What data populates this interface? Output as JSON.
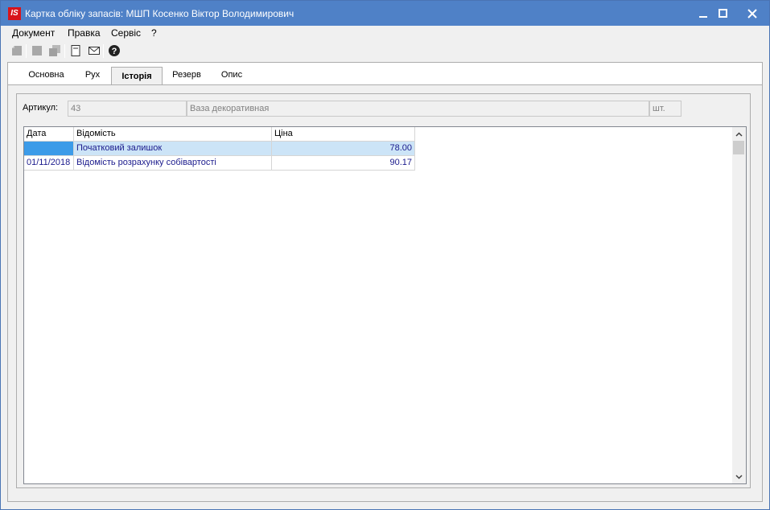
{
  "window": {
    "title": "Картка обліку запасів: МШП Косенко Віктор Володимирович",
    "logo_text": "IS",
    "colors": {
      "titlebar": "#4f81c7",
      "logo": "#d8141b",
      "selection": "#cce4f7",
      "selection_marker": "#3c9be8"
    }
  },
  "menu": {
    "items": [
      "Документ",
      "Правка",
      "Сервіс",
      "?"
    ]
  },
  "toolbar": {
    "icons": [
      "new-disabled-icon",
      "save-disabled-icon",
      "copy-disabled-icon",
      "document-icon",
      "mail-icon",
      "help-icon"
    ]
  },
  "tabs": [
    {
      "label": "Основна",
      "active": false
    },
    {
      "label": "Рух",
      "active": false
    },
    {
      "label": "Історія",
      "active": true
    },
    {
      "label": "Резерв",
      "active": false
    },
    {
      "label": "Опис",
      "active": false
    }
  ],
  "article": {
    "label": "Артикул:",
    "code": "43",
    "name": "Ваза декоративная",
    "unit": "шт."
  },
  "grid": {
    "columns": [
      "Дата",
      "Відомість",
      "Ціна"
    ],
    "rows": [
      {
        "date": "",
        "statement": "Початковий залишок",
        "price": "78.00",
        "selected": true
      },
      {
        "date": "01/11/2018",
        "statement": "Відомість розрахунку собівартості",
        "price": "90.17",
        "selected": false
      }
    ]
  }
}
